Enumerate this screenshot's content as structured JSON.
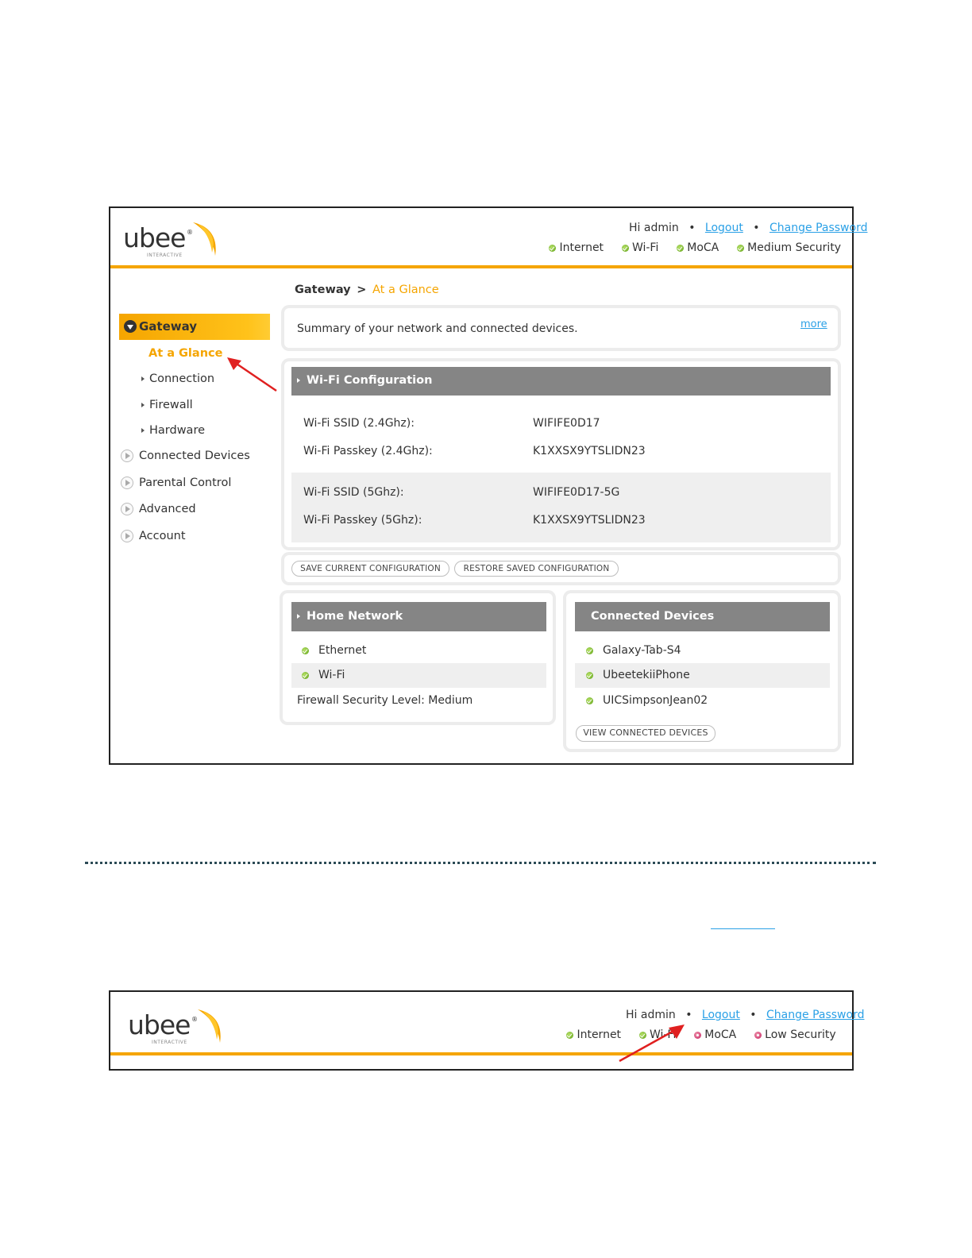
{
  "logo": {
    "word": "ubee",
    "registered": "®",
    "tagline": "INTERACTIVE"
  },
  "header": {
    "greeting": "Hi admin",
    "logout": "Logout",
    "change_password": "Change Password",
    "separator": "•",
    "statuses": [
      {
        "label": "Internet",
        "state": "ok"
      },
      {
        "label": "Wi-Fi",
        "state": "ok"
      },
      {
        "label": "MoCA",
        "state": "ok"
      },
      {
        "label": "Medium Security",
        "state": "ok"
      }
    ]
  },
  "breadcrumb": {
    "root": "Gateway",
    "sep": ">",
    "current": "At a Glance"
  },
  "sidebar": {
    "section": "Gateway",
    "active": "At a Glance",
    "sub_items": [
      "Connection",
      "Firewall",
      "Hardware"
    ],
    "items": [
      "Connected Devices",
      "Parental Control",
      "Advanced",
      "Account"
    ]
  },
  "summary": {
    "text": "Summary of your network and connected devices.",
    "more": "more"
  },
  "wifi": {
    "title": "Wi-Fi Configuration",
    "rows": [
      {
        "label": "Wi-Fi SSID (2.4Ghz):",
        "value": "WIFIFE0D17"
      },
      {
        "label": "Wi-Fi Passkey (2.4Ghz):",
        "value": "K1XXSX9YTSLIDN23"
      },
      {
        "label": "Wi-Fi SSID (5Ghz):",
        "value": "WIFIFE0D17-5G"
      },
      {
        "label": "Wi-Fi Passkey (5Ghz):",
        "value": "K1XXSX9YTSLIDN23"
      }
    ]
  },
  "config_buttons": {
    "save": "SAVE CURRENT CONFIGURATION",
    "restore": "RESTORE SAVED CONFIGURATION"
  },
  "home_network": {
    "title": "Home Network",
    "items": [
      "Ethernet",
      "Wi-Fi"
    ],
    "firewall": "Firewall Security Level: Medium"
  },
  "connected_devices": {
    "title": "Connected Devices",
    "items": [
      "Galaxy-Tab-S4",
      "UbeetekiiPhone",
      "UICSimpsonJean02"
    ],
    "button": "VIEW CONNECTED DEVICES"
  },
  "header2": {
    "greeting": "Hi admin",
    "logout": "Logout",
    "change_password": "Change Password",
    "separator": "•",
    "statuses": [
      {
        "label": "Internet",
        "state": "ok"
      },
      {
        "label": "Wi-Fi",
        "state": "ok"
      },
      {
        "label": "MoCA",
        "state": "bad"
      },
      {
        "label": "Low Security",
        "state": "bad"
      }
    ]
  },
  "colors": {
    "accent": "#f5a500",
    "link": "#2aa0e6",
    "bar": "#858585",
    "arrow": "#e02020"
  }
}
